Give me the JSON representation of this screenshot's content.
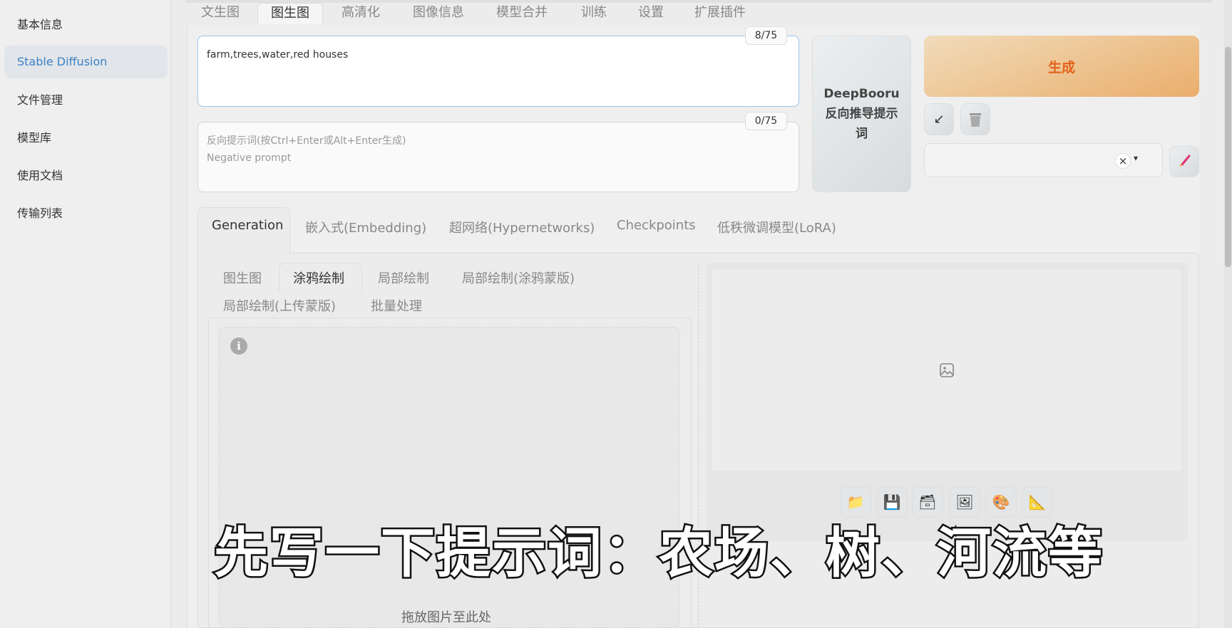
{
  "sidebar": {
    "items": [
      {
        "label": "基本信息"
      },
      {
        "label": "Stable Diffusion"
      },
      {
        "label": "文件管理"
      },
      {
        "label": "模型库"
      },
      {
        "label": "使用文档"
      },
      {
        "label": "传输列表"
      }
    ]
  },
  "top_tabs": [
    "文生图",
    "图生图",
    "高清化",
    "图像信息",
    "模型合并",
    "训练",
    "设置",
    "扩展插件"
  ],
  "prompt": {
    "value": "farm,trees,water,red houses",
    "counter": "8/75"
  },
  "negative_prompt": {
    "placeholder_line1": "反向提示词(按Ctrl+Enter或Alt+Enter生成)",
    "placeholder_line2": "Negative prompt",
    "counter": "0/75"
  },
  "deepbooru": {
    "line1": "DeepBooru",
    "line2": "反向推导提示词"
  },
  "generate": {
    "label": "生成",
    "color": "#e3621b"
  },
  "style_select": {
    "clear": "×",
    "arrow": "▾"
  },
  "model_tabs": [
    "Generation",
    "嵌入式(Embedding)",
    "超网络(Hypernetworks)",
    "Checkpoints",
    "低秩微调模型(LoRA)"
  ],
  "img2img_tabs": [
    "图生图",
    "涂鸦绘制",
    "局部绘制",
    "局部绘制(涂鸦蒙版)",
    "局部绘制(上传蒙版)",
    "批量处理"
  ],
  "drop_area": {
    "text": "拖放图片至此处",
    "info": "i"
  },
  "output_icons": [
    "folder-icon",
    "save-icon",
    "zip-save-icon",
    "image-icon",
    "palette-icon",
    "ruler-icon"
  ],
  "subtitle": "先写一下提示词：农场、树、河流等"
}
